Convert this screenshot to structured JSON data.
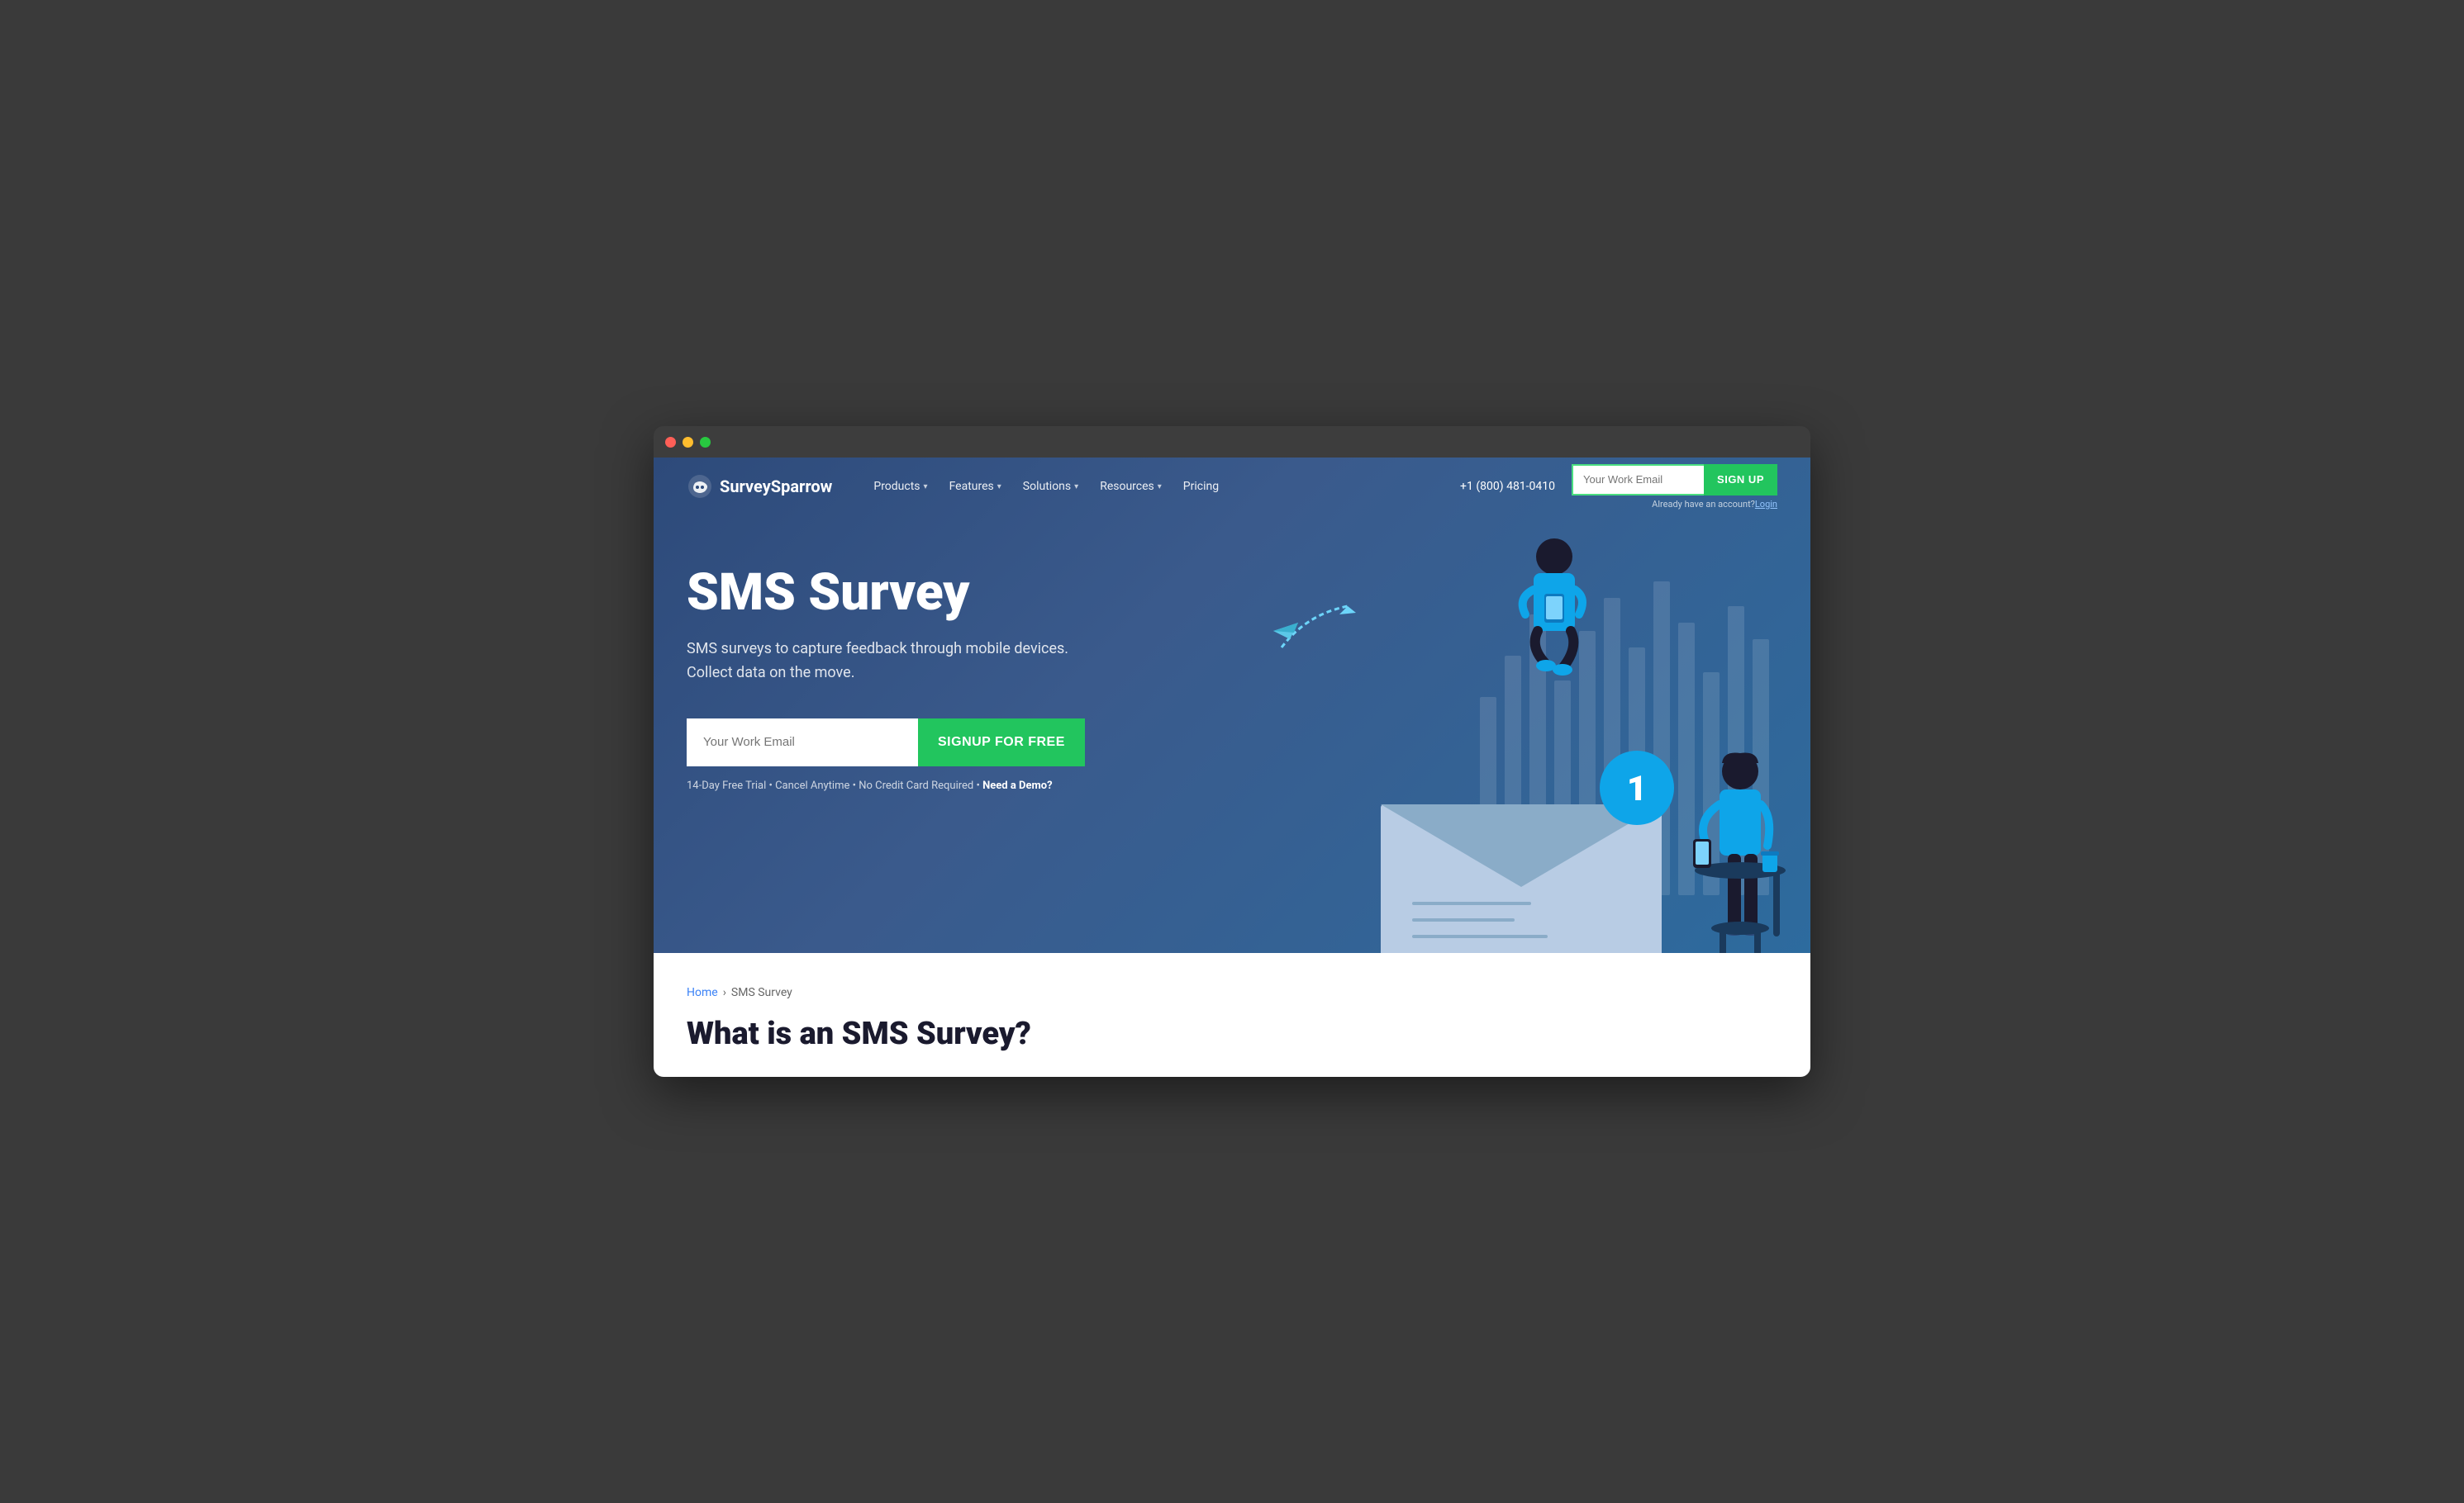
{
  "titlebar": {
    "dots": [
      "red",
      "yellow",
      "green"
    ]
  },
  "navbar": {
    "logo_text": "SurveySparrow",
    "nav_items": [
      {
        "label": "Products",
        "has_dropdown": true
      },
      {
        "label": "Features",
        "has_dropdown": true
      },
      {
        "label": "Solutions",
        "has_dropdown": true
      },
      {
        "label": "Resources",
        "has_dropdown": true
      },
      {
        "label": "Pricing",
        "has_dropdown": false
      }
    ],
    "phone": "+1 (800) 481-0410",
    "email_placeholder": "Your Work Email",
    "signup_btn": "SIGN UP",
    "already_text": "Already have an account?",
    "login_text": "Login"
  },
  "hero": {
    "title": "SMS Survey",
    "subtitle_line1": "SMS surveys to capture feedback through mobile devices.",
    "subtitle_line2": "Collect data on the move.",
    "email_placeholder": "Your Work Email",
    "signup_btn": "SIGNUP FOR FREE",
    "disclaimer": "14-Day Free Trial • Cancel Anytime • No Credit Card Required •",
    "demo_link": "Need a Demo?"
  },
  "breadcrumb": {
    "home": "Home",
    "separator": "›",
    "current": "SMS Survey"
  },
  "bottom": {
    "section_title": "What is an SMS Survey?"
  },
  "colors": {
    "hero_bg": "#2d4a7a",
    "green": "#22c55e",
    "blue_accent": "#0ea5e9"
  }
}
